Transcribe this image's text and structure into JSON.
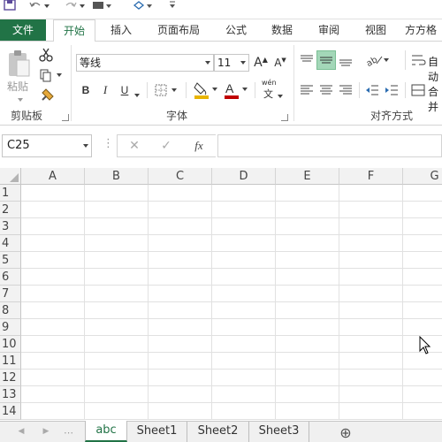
{
  "ribbon_tabs": {
    "file": "文件",
    "home": "开始",
    "insert": "插入",
    "page_layout": "页面布局",
    "formulas": "公式",
    "data": "数据",
    "review": "审阅",
    "view": "视图",
    "fangfang": "方方格"
  },
  "clipboard": {
    "paste_label": "粘贴",
    "group_label": "剪贴板"
  },
  "font": {
    "font_name": "等线",
    "font_size": "11",
    "group_label": "字体",
    "bold": "B",
    "italic": "I",
    "underline": "U",
    "wen": "wén",
    "wen_char": "文",
    "fill_color": "#e8b400",
    "font_color": "#c00000"
  },
  "alignment": {
    "group_label": "对齐方式",
    "wrap_label": "自动",
    "merge_label": "合并"
  },
  "formula_bar": {
    "name_box": "C25",
    "fx": "fx",
    "formula": ""
  },
  "grid": {
    "columns": [
      "A",
      "B",
      "C",
      "D",
      "E",
      "F",
      "G"
    ],
    "rows": [
      "1",
      "2",
      "3",
      "4",
      "5",
      "6",
      "7",
      "8",
      "9",
      "10",
      "11",
      "12",
      "13",
      "14"
    ]
  },
  "sheets": {
    "tabs": [
      "abc",
      "Sheet1",
      "Sheet2",
      "Sheet3"
    ],
    "active": "abc",
    "add": "⊕"
  },
  "colors": {
    "accent": "#217346",
    "active_align": "#a3d7b8"
  }
}
